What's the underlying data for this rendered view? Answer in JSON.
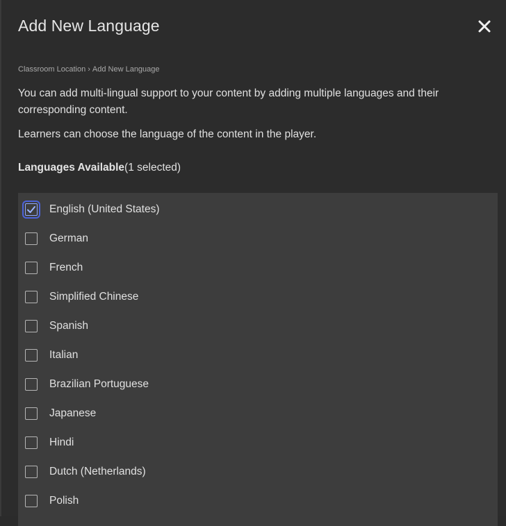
{
  "dialog": {
    "title": "Add New Language",
    "close_icon": "close-icon"
  },
  "breadcrumb": {
    "parent": "Classroom Location",
    "separator": "›",
    "current": "Add New Language"
  },
  "description": {
    "line1": "You can add multi-lingual support to your content by adding multiple languages and their corresponding content.",
    "line2": "Learners can choose the language of the content in the player."
  },
  "languages": {
    "heading": "Languages Available",
    "selected_count": "(1 selected)",
    "items": [
      {
        "label": "English (United States)",
        "checked": true
      },
      {
        "label": "German",
        "checked": false
      },
      {
        "label": "French",
        "checked": false
      },
      {
        "label": "Simplified Chinese",
        "checked": false
      },
      {
        "label": "Spanish",
        "checked": false
      },
      {
        "label": "Italian",
        "checked": false
      },
      {
        "label": "Brazilian Portuguese",
        "checked": false
      },
      {
        "label": "Japanese",
        "checked": false
      },
      {
        "label": "Hindi",
        "checked": false
      },
      {
        "label": "Dutch (Netherlands)",
        "checked": false
      },
      {
        "label": "Polish",
        "checked": false
      }
    ]
  },
  "colors": {
    "background": "#2c2c2c",
    "list_background": "#3d3d3d",
    "check_accent": "#4c63d9"
  }
}
